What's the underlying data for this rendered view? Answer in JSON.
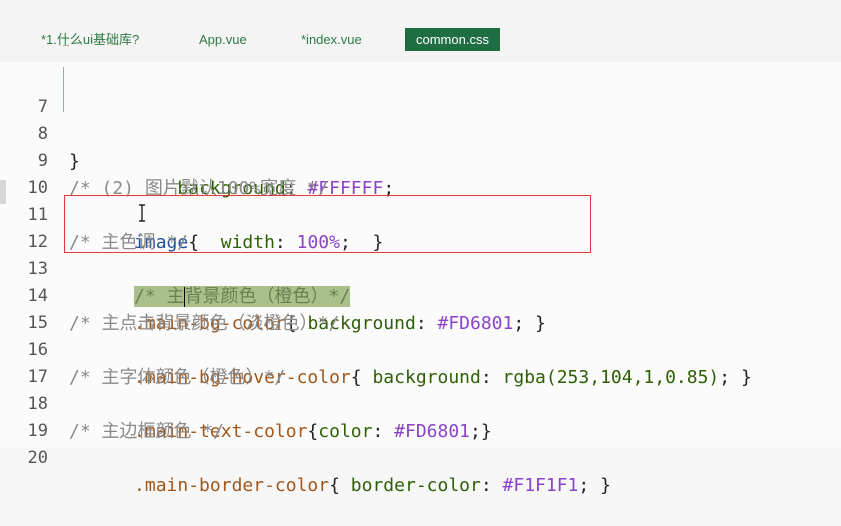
{
  "tabs": [
    {
      "label": "*1.什么ui基础库?",
      "active": false
    },
    {
      "label": "App.vue",
      "active": false
    },
    {
      "label": "*index.vue",
      "active": false
    },
    {
      "label": "common.css",
      "active": true
    }
  ],
  "lines": [
    {
      "n": "7",
      "tokens": [
        "    ",
        "background",
        ": ",
        "#FFFFFF",
        ";"
      ]
    },
    {
      "n": "8",
      "tokens": [
        "}"
      ]
    },
    {
      "n": "9",
      "tokens": [
        "/* (2) 图片默认100%宽度 */"
      ]
    },
    {
      "n": "10",
      "tokens": [
        "image",
        "{  ",
        "width",
        ": ",
        "100%",
        ";  }"
      ]
    },
    {
      "n": "11",
      "tokens": [
        "/* 主色调 */"
      ]
    },
    {
      "n": "12",
      "tokens": [
        "/* 主",
        "背景颜色（橙色）*/"
      ]
    },
    {
      "n": "13",
      "tokens": [
        ".main-bg-color",
        "{ ",
        "background",
        ": ",
        "#FD6801",
        "; }"
      ]
    },
    {
      "n": "14",
      "tokens": [
        "/* 主点击背景颜色（淡橙色）*/"
      ]
    },
    {
      "n": "15",
      "tokens": [
        ".main-bg-hover-color",
        "{ ",
        "background",
        ": ",
        "rgba(253,104,1,0.85)",
        "; }"
      ]
    },
    {
      "n": "16",
      "tokens": [
        "/* 主字体颜色（橙色）*/"
      ]
    },
    {
      "n": "17",
      "tokens": [
        ".main-text-color",
        "{",
        "color",
        ": ",
        "#FD6801",
        ";}"
      ]
    },
    {
      "n": "18",
      "tokens": [
        "/* 主边框颜色 */"
      ]
    },
    {
      "n": "19",
      "tokens": [
        ".main-border-color",
        "{ ",
        "border-color",
        ": ",
        "#F1F1F1",
        "; }"
      ]
    },
    {
      "n": "20",
      "tokens": []
    }
  ],
  "colors": {
    "active_tab_bg": "#1F6E43",
    "annotation_box": "#E43A3A",
    "selection": "#A9C08A"
  }
}
